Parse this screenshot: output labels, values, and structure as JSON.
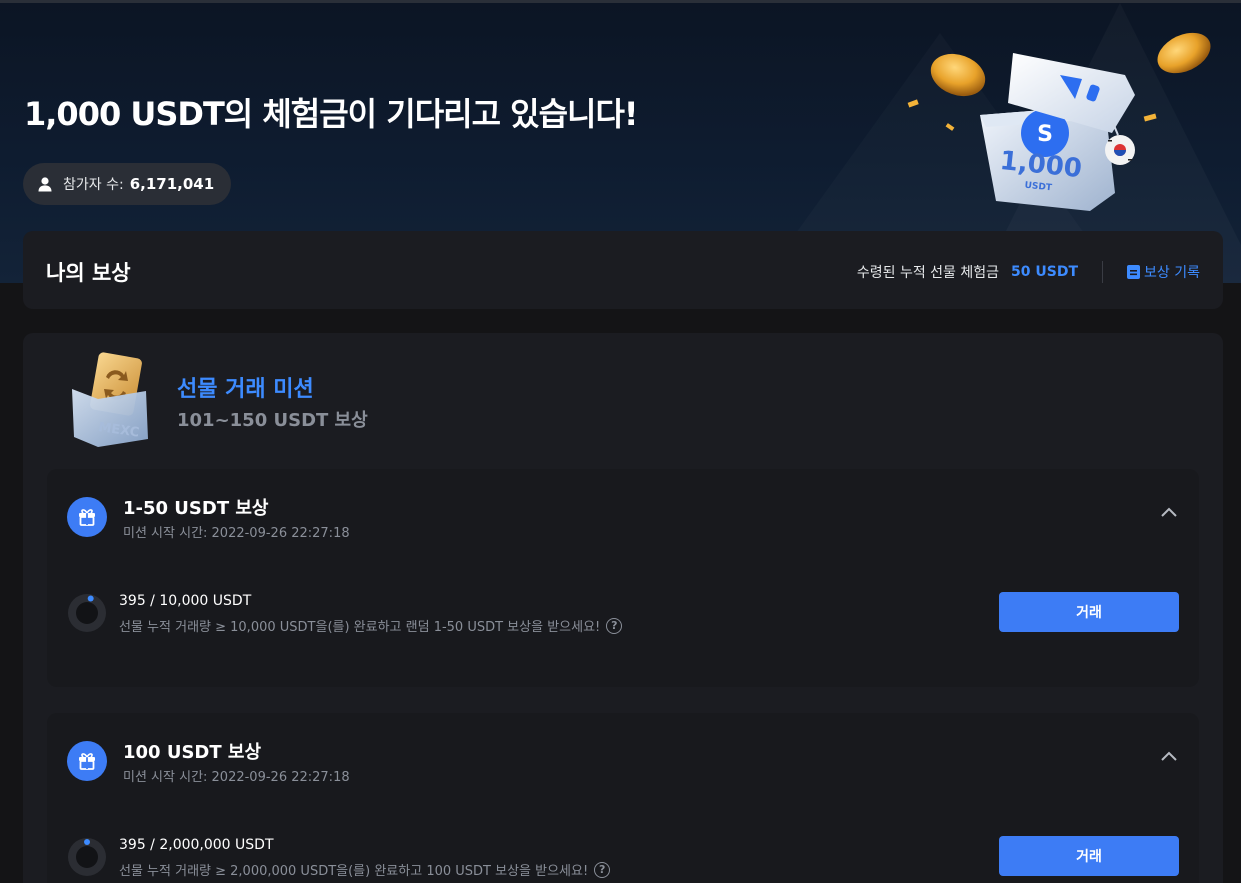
{
  "hero": {
    "title": "1,000 USDT의 체험금이 기다리고 있습니다!",
    "participants_label": "참가자 수:",
    "participants_count": "6,171,041",
    "box_amount": "1,000",
    "box_unit": "USDT"
  },
  "rewards": {
    "title": "나의 보상",
    "cumulative_label": "수령된 누적 선물 체험금",
    "cumulative_value": "50 USDT",
    "history_label": "보상 기록"
  },
  "mission": {
    "title": "선물 거래 미션",
    "subtitle": "101~150 USDT 보상",
    "tiers": [
      {
        "title": "1-50 USDT 보상",
        "start_time": "미션 시작 시간: 2022-09-26 22:27:18",
        "progress_text": "395 / 10,000 USDT",
        "progress_ratio": 0.0395,
        "description": "선물 누적 거래량 ≥ 10,000 USDT을(를) 완료하고 랜덤 1-50 USDT 보상을 받으세요!",
        "button_label": "거래"
      },
      {
        "title": "100 USDT 보상",
        "start_time": "미션 시작 시간: 2022-09-26 22:27:18",
        "progress_text": "395 / 2,000,000 USDT",
        "progress_ratio": 0.0002,
        "description": "선물 누적 거래량 ≥ 2,000,000 USDT을(를) 완료하고 100 USDT 보상을 받으세요!",
        "button_label": "거래"
      }
    ]
  },
  "colors": {
    "accent": "#3d7cf5",
    "link": "#3d8bff",
    "background": "#141416",
    "card": "#1b1c21"
  }
}
